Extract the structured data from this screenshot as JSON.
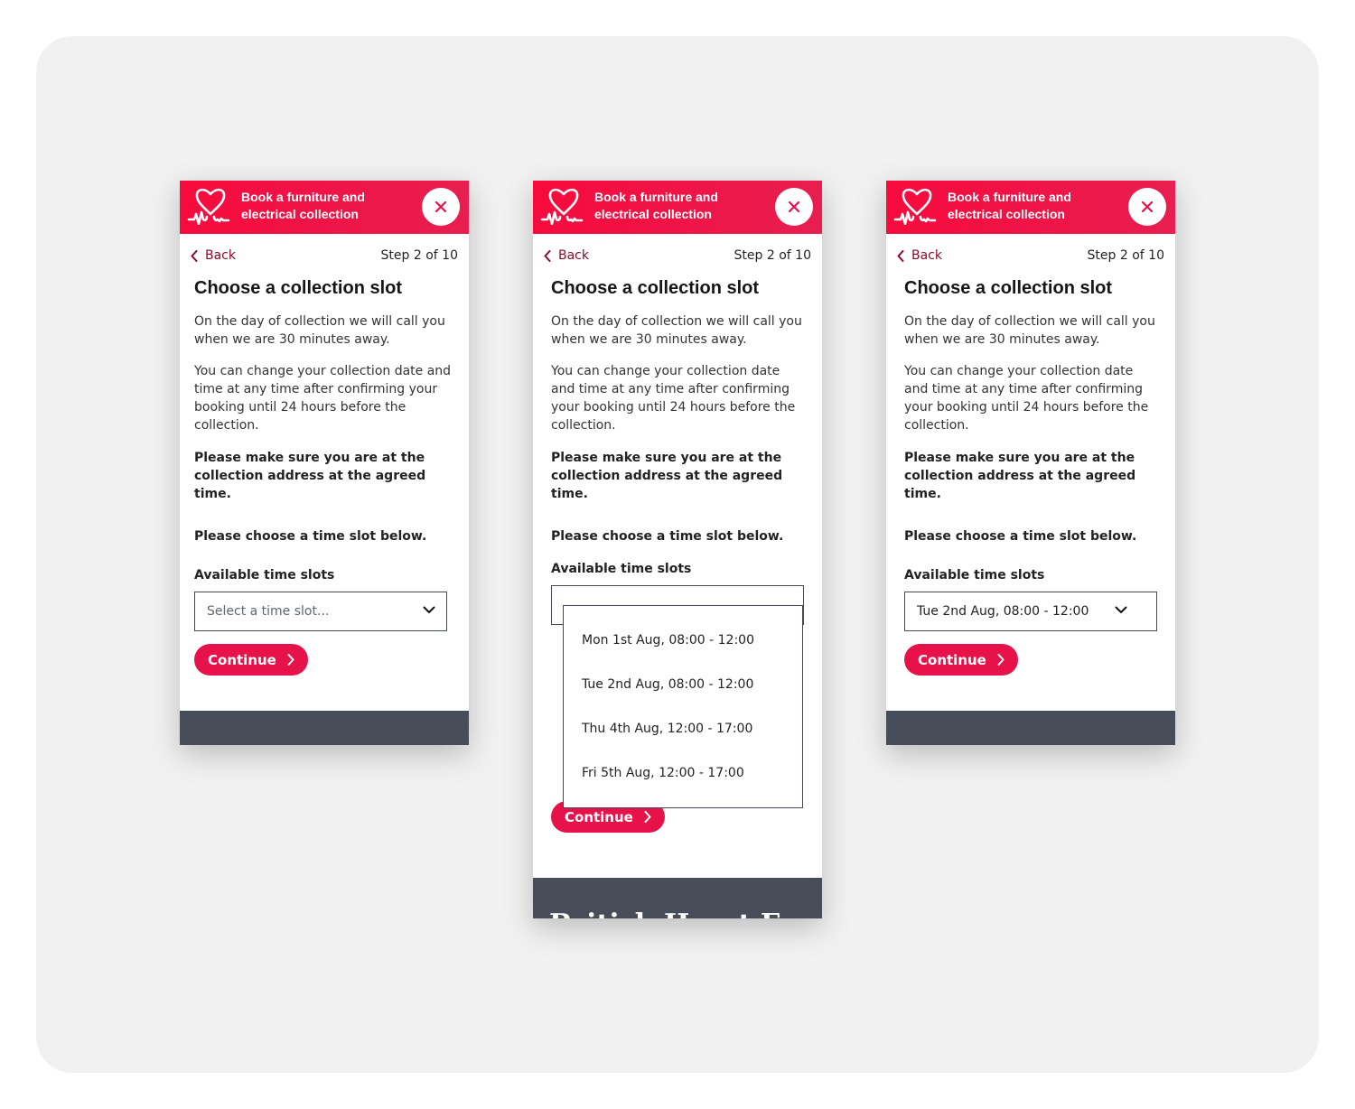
{
  "header": {
    "title": "Book a furniture and electrical collection",
    "close_label": "close"
  },
  "nav": {
    "back_label": "Back",
    "step_label": "Step 2 of 10"
  },
  "page": {
    "heading": "Choose a collection slot",
    "para1": "On the day of collection we will call you when we are 30 minutes away.",
    "para2": "You can change your collection date and time at any time after confirming your booking until 24 hours before the collection.",
    "para3": "Please make sure you are at the collection address at the agreed time.",
    "para4": "Please choose a time slot below.",
    "slots_label": "Available time slots",
    "continue_label": "Continue"
  },
  "select": {
    "placeholder": "Select a time slot...",
    "selected_value": "Tue 2nd Aug, 08:00 - 12:00",
    "options": [
      "Mon 1st Aug, 08:00 - 12:00",
      "Tue 2nd Aug, 08:00 - 12:00",
      "Thu 4th Aug, 12:00 - 17:00",
      "Fri 5th Aug, 12:00 - 17:00"
    ]
  },
  "footer": {
    "brand": "British Heart Foundation"
  },
  "colors": {
    "brand_red": "#e8124a",
    "header_red": "#f70a3d",
    "footer_grey": "#474e5a",
    "back_link": "#8a0a2a"
  }
}
